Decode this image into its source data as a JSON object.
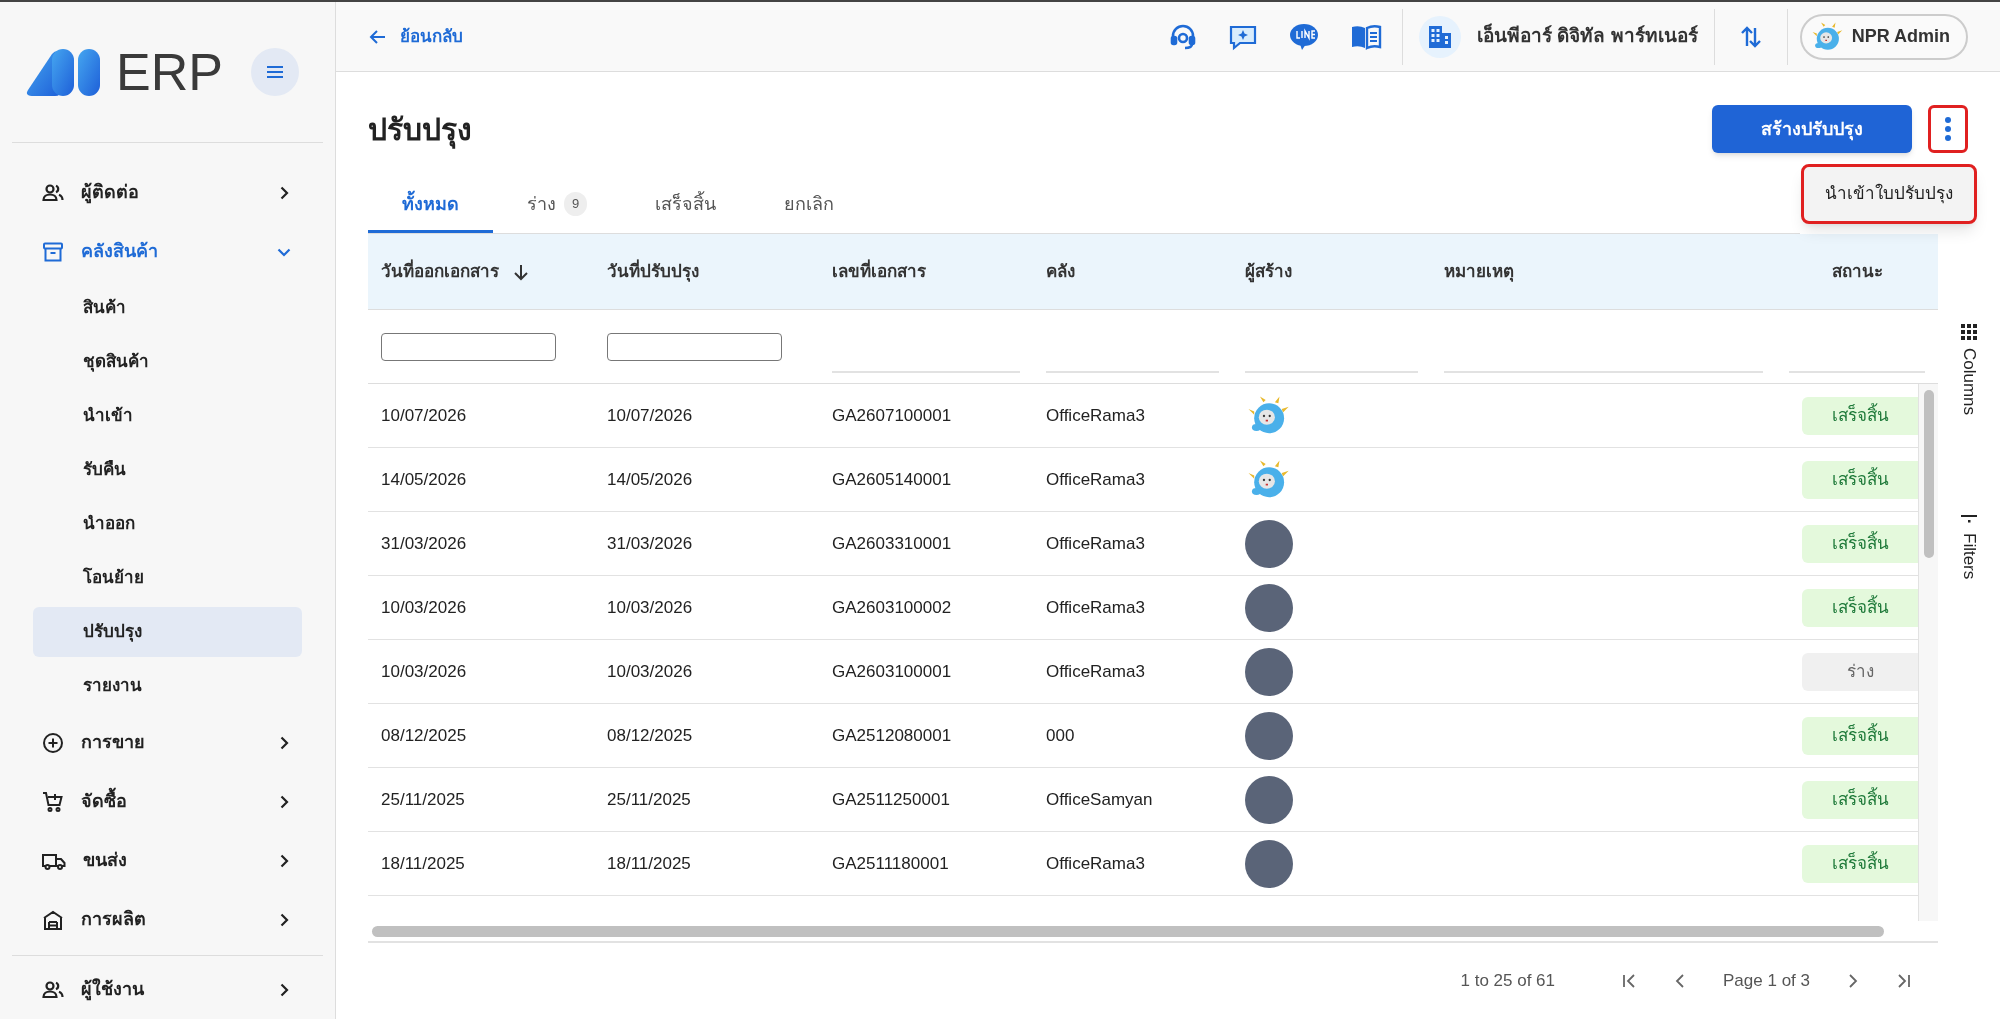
{
  "sidebar": {
    "logo_text": "ERP",
    "items": [
      {
        "label": "ผู้ติดต่อ",
        "expanded": false
      },
      {
        "label": "คลังสินค้า",
        "expanded": true,
        "children": [
          {
            "label": "สินค้า",
            "selected": false
          },
          {
            "label": "ชุดสินค้า",
            "selected": false
          },
          {
            "label": "นำเข้า",
            "selected": false
          },
          {
            "label": "รับคืน",
            "selected": false
          },
          {
            "label": "นำออก",
            "selected": false
          },
          {
            "label": "โอนย้าย",
            "selected": false
          },
          {
            "label": "ปรับปรุง",
            "selected": true
          },
          {
            "label": "รายงาน",
            "selected": false
          }
        ]
      },
      {
        "label": "การขาย",
        "expanded": false
      },
      {
        "label": "จัดซื้อ",
        "expanded": false
      },
      {
        "label": "ขนส่ง",
        "expanded": false
      },
      {
        "label": "การผลิต",
        "expanded": false
      }
    ],
    "footer_items": [
      {
        "label": "ผู้ใช้งาน",
        "expanded": false
      }
    ]
  },
  "topbar": {
    "back": "ย้อนกลับ",
    "company": "เอ็นพีอาร์ ดิจิทัล พาร์ทเนอร์",
    "user": "NPR Admin"
  },
  "page": {
    "title": "ปรับปรุง",
    "create_button": "สร้างปรับปรุง",
    "more_button": {
      "highlighted": true
    },
    "menu": [
      {
        "label": "นำเข้าใบปรับปรุง",
        "highlighted": true
      }
    ]
  },
  "tabs": [
    {
      "label": "ทั้งหมด",
      "selected": true
    },
    {
      "label": "ร่าง",
      "count": "9",
      "selected": false
    },
    {
      "label": "เสร็จสิ้น",
      "selected": false
    },
    {
      "label": "ยกเลิก",
      "selected": false
    }
  ],
  "table": {
    "columns": [
      {
        "label": "วันที่ออกเอกสาร",
        "sorted": true,
        "kind": "date"
      },
      {
        "label": "วันที่ปรับปรุง",
        "sorted": false,
        "kind": "date"
      },
      {
        "label": "เลขที่เอกสาร",
        "sorted": false,
        "kind": "text"
      },
      {
        "label": "คลัง",
        "sorted": false,
        "kind": "text"
      },
      {
        "label": "ผู้สร้าง",
        "sorted": false,
        "kind": "text"
      },
      {
        "label": "หมายเหตุ",
        "sorted": false,
        "kind": "text"
      },
      {
        "label": "สถานะ",
        "sorted": false,
        "kind": "text"
      }
    ],
    "rows": [
      {
        "issue_date": "10/07/2026",
        "adjust_date": "10/07/2026",
        "doc_no": "GA2607100001",
        "warehouse": "OfficeRama3",
        "creator": {
          "kind": "mascot"
        },
        "status": {
          "label": "เสร็จสิ้น",
          "kind": "done"
        }
      },
      {
        "issue_date": "14/05/2026",
        "adjust_date": "14/05/2026",
        "doc_no": "GA2605140001",
        "warehouse": "OfficeRama3",
        "creator": {
          "kind": "mascot"
        },
        "status": {
          "label": "เสร็จสิ้น",
          "kind": "done"
        }
      },
      {
        "issue_date": "31/03/2026",
        "adjust_date": "31/03/2026",
        "doc_no": "GA2603310001",
        "warehouse": "OfficeRama3",
        "creator": {
          "kind": "photo"
        },
        "status": {
          "label": "เสร็จสิ้น",
          "kind": "done"
        }
      },
      {
        "issue_date": "10/03/2026",
        "adjust_date": "10/03/2026",
        "doc_no": "GA2603100002",
        "warehouse": "OfficeRama3",
        "creator": {
          "kind": "photo"
        },
        "status": {
          "label": "เสร็จสิ้น",
          "kind": "done"
        }
      },
      {
        "issue_date": "10/03/2026",
        "adjust_date": "10/03/2026",
        "doc_no": "GA2603100001",
        "warehouse": "OfficeRama3",
        "creator": {
          "kind": "photo"
        },
        "status": {
          "label": "ร่าง",
          "kind": "draft"
        }
      },
      {
        "issue_date": "08/12/2025",
        "adjust_date": "08/12/2025",
        "doc_no": "GA2512080001",
        "warehouse": "000",
        "creator": {
          "kind": "photo"
        },
        "status": {
          "label": "เสร็จสิ้น",
          "kind": "done"
        }
      },
      {
        "issue_date": "25/11/2025",
        "adjust_date": "25/11/2025",
        "doc_no": "GA2511250001",
        "warehouse": "OfficeSamyan",
        "creator": {
          "kind": "photo"
        },
        "status": {
          "label": "เสร็จสิ้น",
          "kind": "done"
        }
      },
      {
        "issue_date": "18/11/2025",
        "adjust_date": "18/11/2025",
        "doc_no": "GA2511180001",
        "warehouse": "OfficeRama3",
        "creator": {
          "kind": "photo"
        },
        "status": {
          "label": "เสร็จสิ้น",
          "kind": "done"
        }
      }
    ]
  },
  "side_panel": [
    {
      "label": "Columns"
    },
    {
      "label": "Filters"
    }
  ],
  "pagination": {
    "range": "1 to 25 of 61",
    "page": "Page 1 of 3"
  }
}
